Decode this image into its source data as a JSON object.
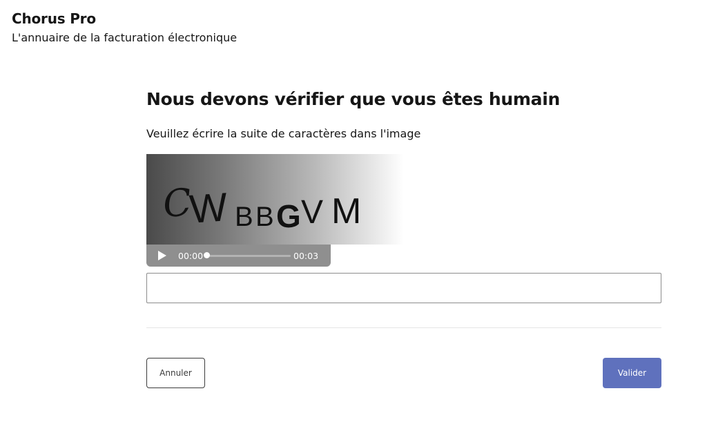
{
  "header": {
    "title": "Chorus Pro",
    "subtitle": "L'annuaire de la facturation électronique"
  },
  "main": {
    "heading": "Nous devons vérifier que vous êtes humain",
    "instruction": "Veuillez écrire la suite de caractères dans l'image",
    "captcha": {
      "text": "CWBBGVM"
    },
    "audio": {
      "current_time": "00:00",
      "total_time": "00:03",
      "progress": 0,
      "play_icon": "play-icon"
    },
    "answer": {
      "value": "",
      "placeholder": ""
    },
    "actions": {
      "cancel_label": "Annuler",
      "validate_label": "Valider"
    }
  },
  "colors": {
    "validate_button": "#5f71bd",
    "audio_bar": "#8f8f8f",
    "text": "#161616"
  }
}
